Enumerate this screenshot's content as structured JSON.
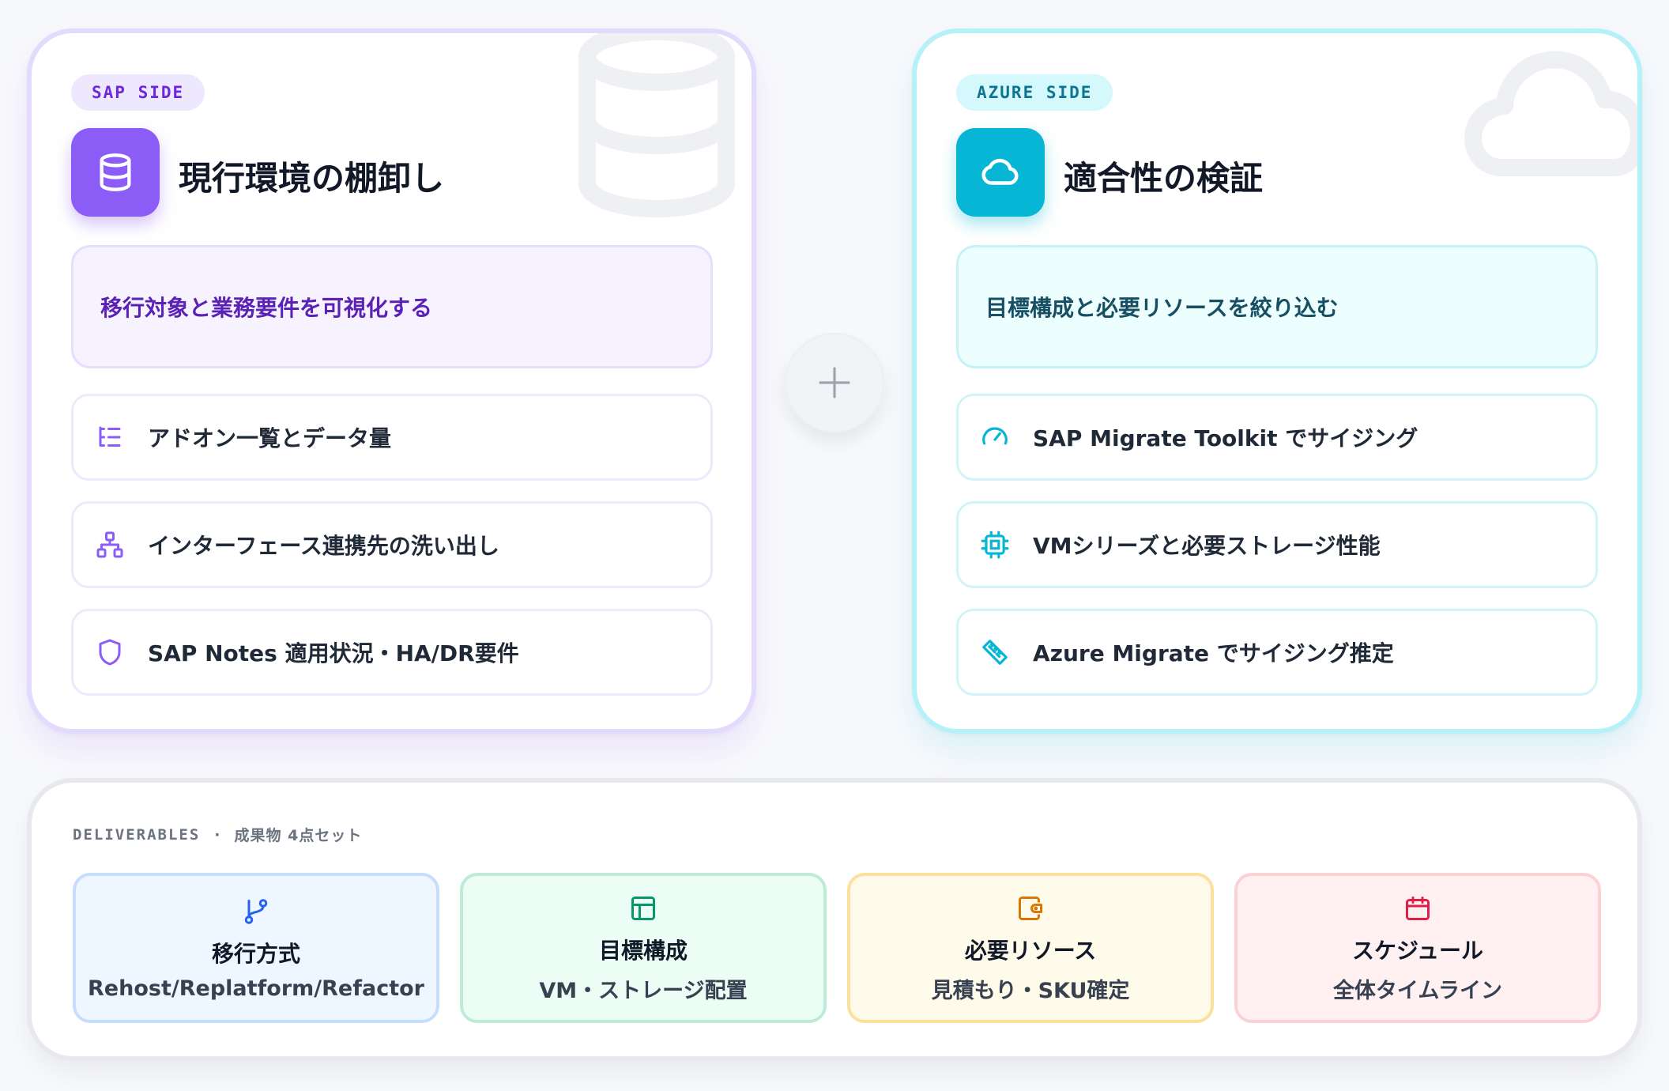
{
  "sap": {
    "badge": "SAP SIDE",
    "title": "現行環境の棚卸し",
    "goal": "移行対象と業務要件を可視化する",
    "items": [
      {
        "label": "アドオン一覧とデータ量",
        "icon": "list-tree-icon"
      },
      {
        "label": "インターフェース連携先の洗い出し",
        "icon": "network-icon"
      },
      {
        "label": "SAP Notes 適用状況・HA/DR要件",
        "icon": "shield-icon"
      }
    ],
    "accent": "#8b5cf6"
  },
  "azure": {
    "badge": "AZURE SIDE",
    "title": "適合性の検証",
    "goal": "目標構成と必要リソースを絞り込む",
    "items": [
      {
        "label": "SAP Migrate Toolkit でサイジング",
        "icon": "gauge-icon"
      },
      {
        "label": "VMシリーズと必要ストレージ性能",
        "icon": "cpu-chip-icon"
      },
      {
        "label": "Azure Migrate でサイジング推定",
        "icon": "ruler-icon"
      }
    ],
    "accent": "#06b6d4"
  },
  "connector": {
    "icon": "plus-icon"
  },
  "deliverables": {
    "label_en": "DELIVERABLES",
    "separator": "·",
    "label_jp": "成果物 4点セット",
    "tiles": [
      {
        "title": "移行方式",
        "subtitle": "Rehost/Replatform/Refactor",
        "icon": "git-branch-icon",
        "color": "#2563eb"
      },
      {
        "title": "目標構成",
        "subtitle": "VM・ストレージ配置",
        "icon": "layout-icon",
        "color": "#059669"
      },
      {
        "title": "必要リソース",
        "subtitle": "見積もり・SKU確定",
        "icon": "wallet-icon",
        "color": "#d97706"
      },
      {
        "title": "スケジュール",
        "subtitle": "全体タイムライン",
        "icon": "calendar-icon",
        "color": "#e11d48"
      }
    ]
  }
}
